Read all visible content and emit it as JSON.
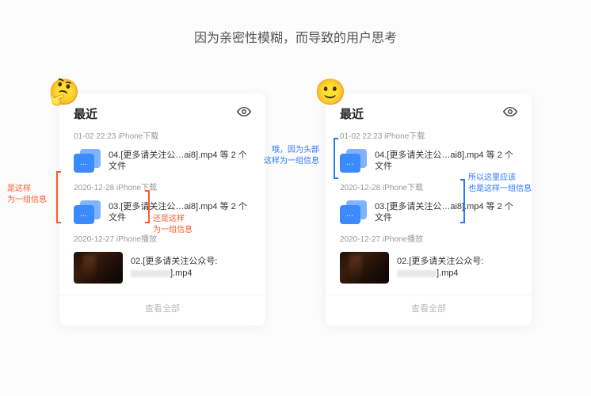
{
  "title": "因为亲密性模糊，而导致的用户思考",
  "left": {
    "emoji": "🤔",
    "section": "最近",
    "dates": [
      "01-02 22:23 iPhone下载",
      "2020-12-28 iPhone下载",
      "2020-12-27 iPhone播放"
    ],
    "file1": "04.[更多请关注公…ai8].mp4 等 2 个文件",
    "file2": "03.[更多请关注公…ai8].mp4 等 2 个文件",
    "file3a": "02.[更多请关注公众号:",
    "file3b": "].mp4",
    "view_all": "查看全部",
    "ann_left": "是这样\n为一组信息",
    "ann_right": "还是这样\n为一组信息"
  },
  "right": {
    "emoji": "🙂",
    "section": "最近",
    "dates": [
      "01-02 22:23 iPhone下载",
      "2020-12-28 iPhone下载",
      "2020-12-27 iPhone播放"
    ],
    "file1": "04.[更多请关注公…ai8].mp4 等 2 个文件",
    "file2": "03.[更多请关注公…ai8].mp4 等 2 个文件",
    "file3a": "02.[更多请关注公众号:",
    "file3b": "].mp4",
    "view_all": "查看全部",
    "ann_top": "哦，因为头部\n这样为一组信息",
    "ann_right": "所以这里应该\n也是这样一组信息"
  }
}
